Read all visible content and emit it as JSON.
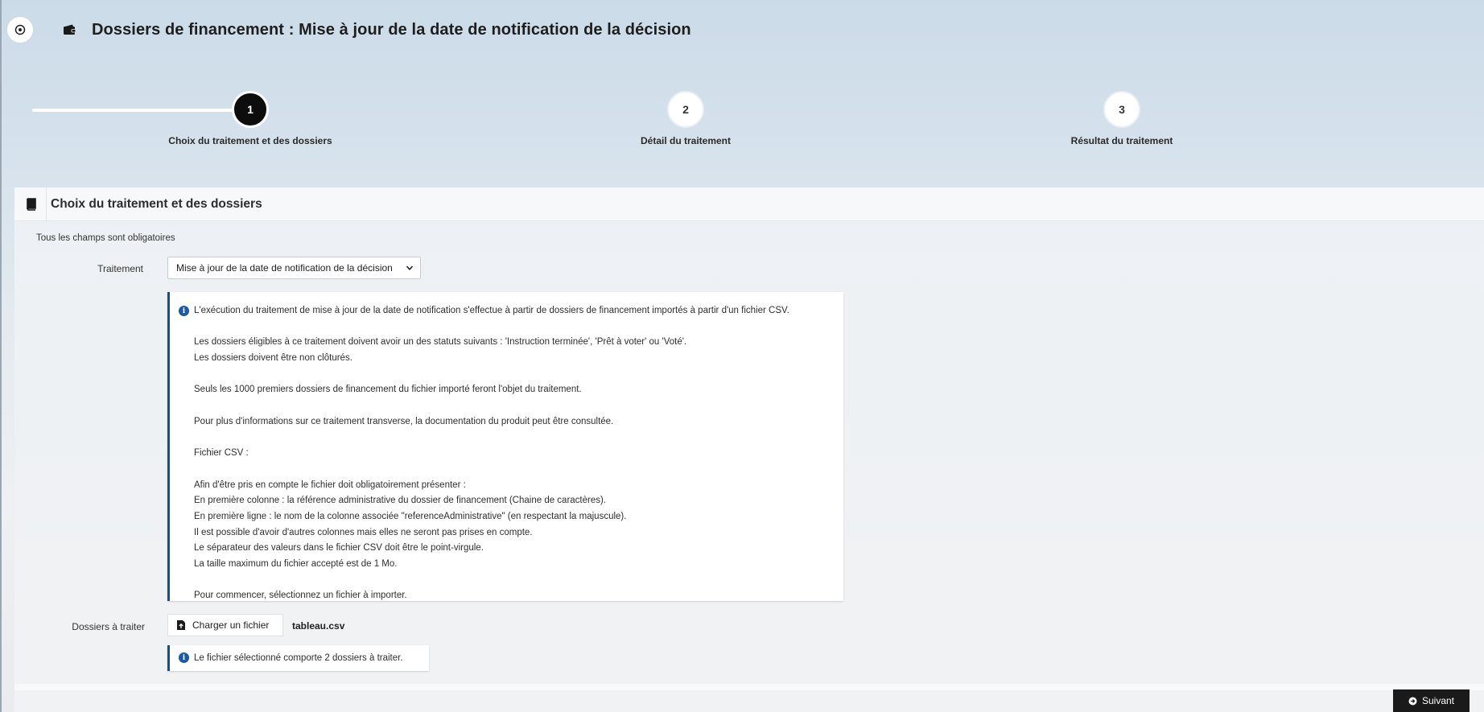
{
  "header": {
    "title": "Dossiers de financement : Mise à jour de la date de notification de la décision",
    "collapse_icon": "collapse-circle-icon",
    "title_icon": "wallet-icon"
  },
  "stepper": {
    "steps": [
      {
        "number": "1",
        "label": "Choix du traitement et des dossiers",
        "active": true
      },
      {
        "number": "2",
        "label": "Détail du traitement",
        "active": false
      },
      {
        "number": "3",
        "label": "Résultat du traitement",
        "active": false
      }
    ]
  },
  "panel": {
    "title": "Choix du traitement et des dossiers",
    "icon": "book-icon",
    "required_note": "Tous les champs sont obligatoires",
    "treatment": {
      "label": "Traitement",
      "selected": "Mise à jour de la date de notification de la décision"
    },
    "info": {
      "lines": [
        "L'exécution du traitement de mise à jour de la date de notification s'effectue à partir de dossiers de financement importés à partir d'un fichier CSV.",
        "",
        "Les dossiers éligibles à ce traitement doivent avoir un des statuts suivants : 'Instruction terminée', 'Prêt à voter' ou 'Voté'.",
        "Les dossiers doivent être non clôturés.",
        "",
        "Seuls les 1000 premiers dossiers de financement du fichier importé feront l'objet du traitement.",
        "",
        "Pour plus d'informations sur ce traitement transverse, la documentation du produit peut être consultée.",
        "",
        "Fichier CSV :",
        "",
        "Afin d'être pris en compte le fichier doit obligatoirement présenter :",
        "En première colonne : la référence administrative du dossier de financement (Chaine de caractères).",
        "En première ligne : le nom de la colonne associée \"referenceAdministrative\" (en respectant la majuscule).",
        "Il est possible d'avoir d'autres colonnes mais elles ne seront pas prises en compte.",
        "Le séparateur des valeurs dans le fichier CSV doit être le point-virgule.",
        "La taille maximum du fichier accepté est de 1 Mo.",
        "",
        "Pour commencer, sélectionnez un fichier à importer."
      ]
    },
    "files": {
      "label": "Dossiers à traiter",
      "upload_label": "Charger un fichier",
      "file_name": "tableau.csv",
      "result_message": "Le fichier sélectionné comporte 2 dossiers à traiter."
    }
  },
  "footer": {
    "next_label": "Suivant"
  },
  "colors": {
    "active_step": "#0d0d0d",
    "info_border": "#1f4e79",
    "info_icon": "#1b5aa5",
    "next_button": "#1a1a1a"
  }
}
